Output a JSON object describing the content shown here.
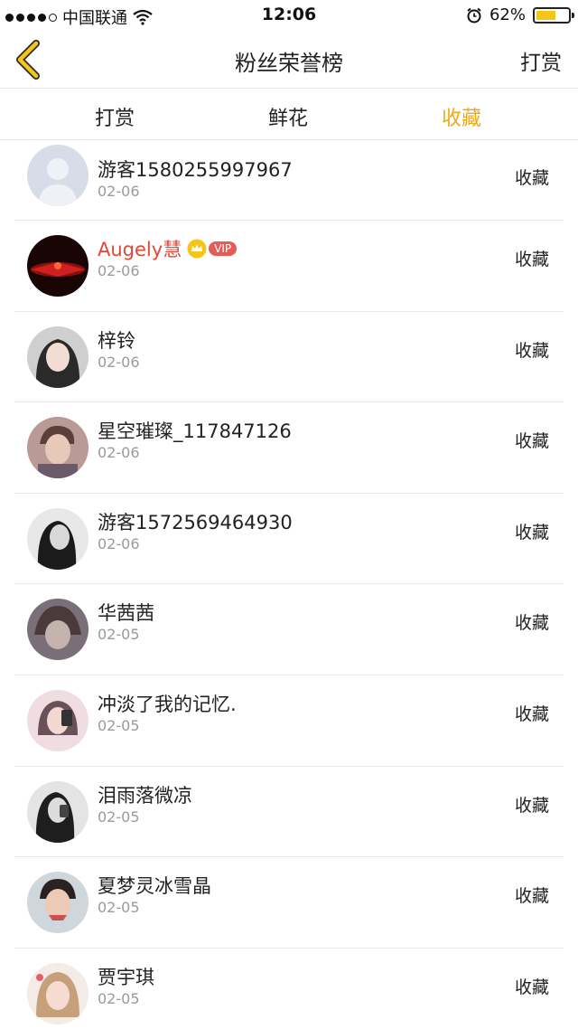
{
  "status_bar": {
    "carrier": "中国联通",
    "time": "12:06",
    "battery": "62%",
    "battery_level": 0.62
  },
  "nav": {
    "title": "粉丝荣誉榜",
    "right_action": "打赏"
  },
  "tabs": [
    {
      "label": "打赏",
      "active": false
    },
    {
      "label": "鲜花",
      "active": false
    },
    {
      "label": "收藏",
      "active": true
    }
  ],
  "accent_color": "#f0a818",
  "rows": [
    {
      "name": "游客1580255997967",
      "date": "02-06",
      "action": "收藏",
      "vip": false
    },
    {
      "name": "Augely慧",
      "date": "02-06",
      "action": "收藏",
      "vip": true,
      "vip_label": "VIP"
    },
    {
      "name": "梓铃",
      "date": "02-06",
      "action": "收藏",
      "vip": false
    },
    {
      "name": "星空璀璨_117847126",
      "date": "02-06",
      "action": "收藏",
      "vip": false
    },
    {
      "name": "游客1572569464930",
      "date": "02-06",
      "action": "收藏",
      "vip": false
    },
    {
      "name": "华茜茜",
      "date": "02-05",
      "action": "收藏",
      "vip": false
    },
    {
      "name": "冲淡了我的记忆.",
      "date": "02-05",
      "action": "收藏",
      "vip": false
    },
    {
      "name": "泪雨落微凉",
      "date": "02-05",
      "action": "收藏",
      "vip": false
    },
    {
      "name": "夏梦灵冰雪晶",
      "date": "02-05",
      "action": "收藏",
      "vip": false
    },
    {
      "name": "贾宇琪",
      "date": "02-05",
      "action": "收藏",
      "vip": false
    }
  ]
}
